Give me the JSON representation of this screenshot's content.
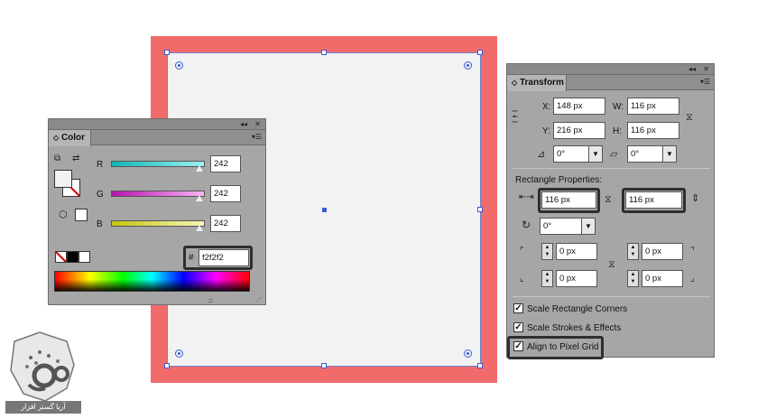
{
  "color_panel": {
    "tab_label": "Color",
    "collapse_glyph": "◂◂",
    "close_glyph": "✕",
    "menu_glyph": "▾☰",
    "channels": [
      {
        "label": "R",
        "value": "242",
        "color": "#22c9c9"
      },
      {
        "label": "G",
        "value": "242",
        "color": "#d020c8"
      },
      {
        "label": "B",
        "value": "242",
        "color": "#d6d61c"
      }
    ],
    "hex_prefix": "#",
    "hex_value": "f2f2f2",
    "fill_color": "#f2f2f2",
    "grip_glyph": "::::::::"
  },
  "transform_panel": {
    "tab_label": "Transform",
    "collapse_glyph": "◂◂",
    "close_glyph": "✕",
    "menu_glyph": "▾☰",
    "x_label": "X:",
    "x_value": "148 px",
    "y_label": "Y:",
    "y_value": "216 px",
    "w_label": "W:",
    "w_value": "116 px",
    "h_label": "H:",
    "h_value": "116 px",
    "rotate_value": "0°",
    "shear_value": "0°",
    "rect_props_title": "Rectangle Properties:",
    "rect_width_value": "116 px",
    "rect_height_value": "116 px",
    "corner_rotate_value": "0°",
    "corner_values": [
      "0 px",
      "0 px",
      "0 px",
      "0 px"
    ],
    "options": [
      {
        "label": "Scale Rectangle Corners",
        "checked": true
      },
      {
        "label": "Scale Strokes & Effects",
        "checked": true
      },
      {
        "label": "Align to Pixel Grid",
        "checked": true
      }
    ]
  },
  "watermark_text": "آریا گستر افزار",
  "colors": {
    "artboard_border": "#f26b6b",
    "artboard_fill": "#f2f2f2",
    "selection": "#3a5bd9",
    "panel_bg": "#a6a6a6"
  }
}
